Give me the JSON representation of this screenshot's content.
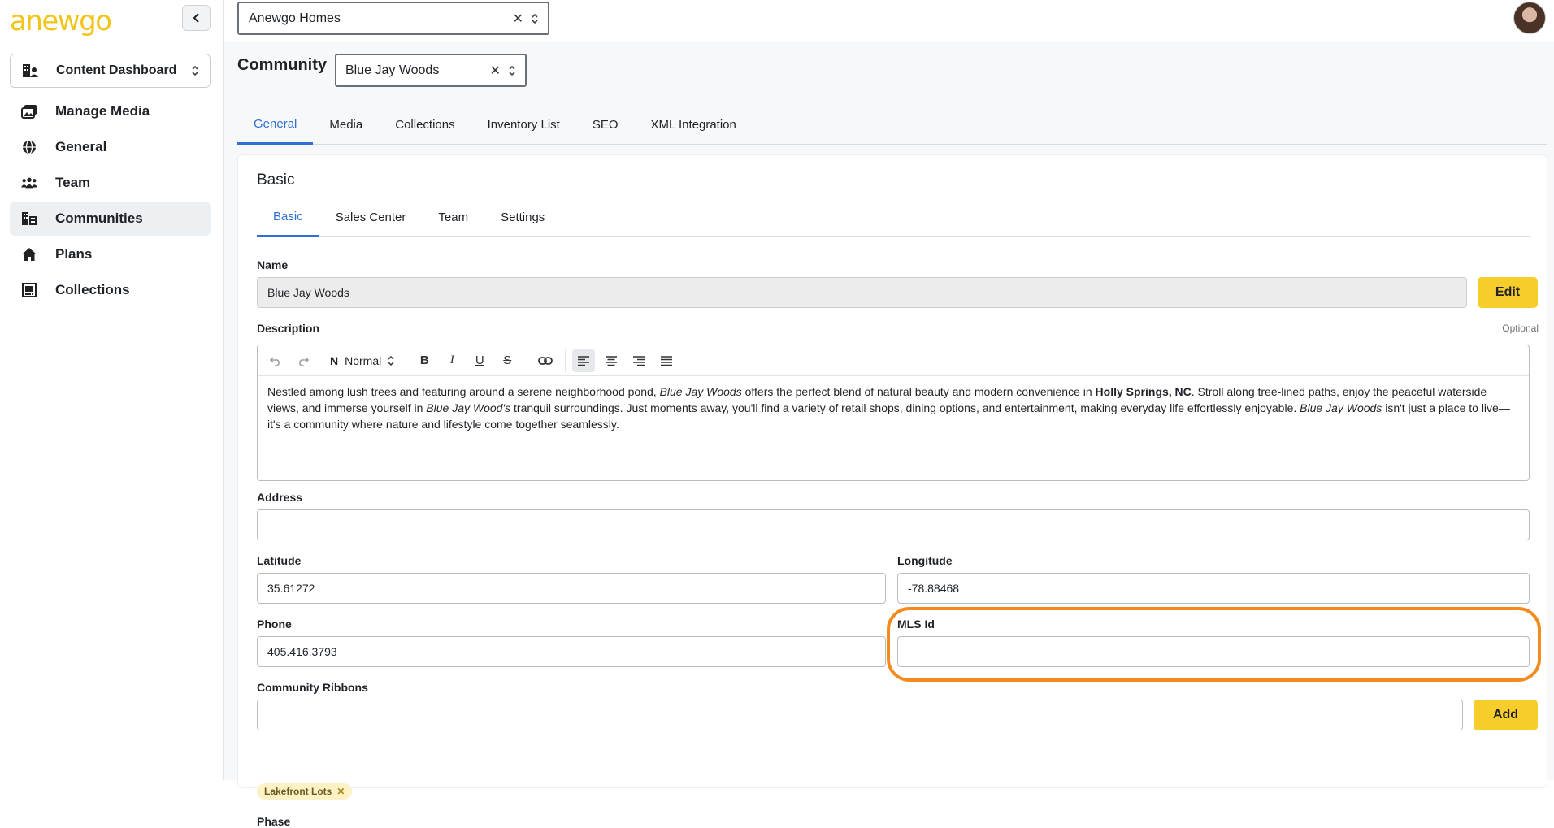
{
  "app": {
    "logo_text": "anewgo",
    "brand_color": "#f2c51a",
    "accent_color": "#2f6fd6",
    "highlight_color": "#f58a1f"
  },
  "sidebar": {
    "dashboard_select": "Content Dashboard",
    "items": [
      {
        "label": "Manage Media",
        "icon": "media-icon"
      },
      {
        "label": "General",
        "icon": "globe-icon"
      },
      {
        "label": "Team",
        "icon": "team-icon"
      },
      {
        "label": "Communities",
        "icon": "buildings-icon",
        "active": true
      },
      {
        "label": "Plans",
        "icon": "home-icon"
      },
      {
        "label": "Collections",
        "icon": "collections-icon"
      }
    ]
  },
  "topbar": {
    "org_select": "Anewgo Homes"
  },
  "page": {
    "title": "Community",
    "community_select": "Blue Jay Woods",
    "tabs": [
      "General",
      "Media",
      "Collections",
      "Inventory List",
      "SEO",
      "XML Integration"
    ]
  },
  "card": {
    "title": "Basic",
    "subtabs": [
      "Basic",
      "Sales Center",
      "Team",
      "Settings"
    ],
    "name": {
      "label": "Name",
      "value": "Blue Jay Woods",
      "edit_label": "Edit"
    },
    "description": {
      "label": "Description",
      "optional": "Optional",
      "block_style": "Normal",
      "p1": "Nestled among lush trees and featuring around a serene neighborhood pond, ",
      "i1": "Blue Jay Woods",
      "p2": " offers the perfect blend of natural beauty and modern convenience in ",
      "b1": "Holly Springs, NC",
      "p3": ". Stroll along tree-lined paths, enjoy the peaceful waterside views, and immerse yourself in ",
      "i2": "Blue Jay Wood's",
      "p4": " tranquil surroundings. Just moments away, you'll find a variety of retail shops, dining options, and entertainment, making everyday life effortlessly enjoyable. ",
      "i3": "Blue Jay Woods",
      "p5": " isn't just a place to live—it's a community where nature and lifestyle come together seamlessly."
    },
    "address": {
      "label": "Address",
      "value": ""
    },
    "latitude": {
      "label": "Latitude",
      "value": "35.61272"
    },
    "longitude": {
      "label": "Longitude",
      "value": "-78.88468"
    },
    "phone": {
      "label": "Phone",
      "value": "405.416.3793"
    },
    "mls": {
      "label": "MLS Id",
      "value": ""
    },
    "ribbons": {
      "label": "Community Ribbons",
      "value": "",
      "add_label": "Add",
      "chips": [
        "Lakefront Lots"
      ]
    },
    "phase": {
      "label": "Phase"
    }
  }
}
